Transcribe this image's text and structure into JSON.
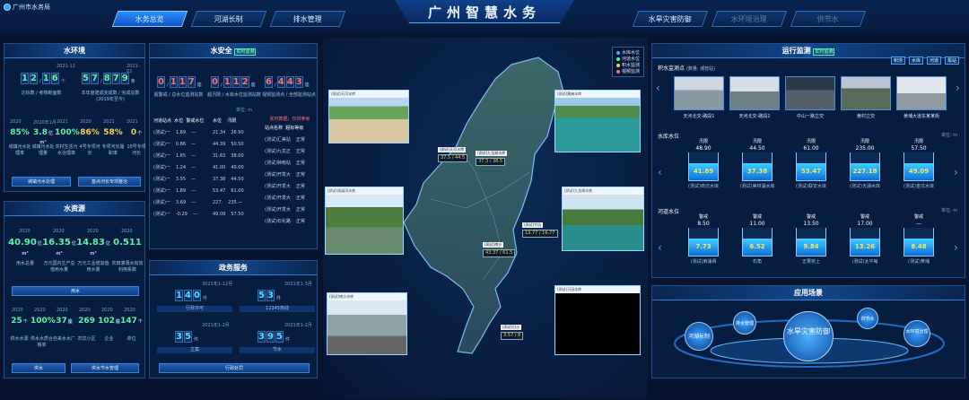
{
  "header": {
    "logo": "广州市水务局",
    "title": "广州智慧水务",
    "tabs_left": [
      "水务总览",
      "河湖长制",
      "排水管理"
    ],
    "tabs_right": [
      "水旱灾害防御",
      "水环境治理",
      "供节水"
    ]
  },
  "water_env": {
    "title": "水环境",
    "years": [
      "2021-12",
      "2021-02"
    ],
    "d1": [
      "1",
      "2",
      "1",
      "6"
    ],
    "d1_unit": "个",
    "d1_label": "达标数 / 考核断面数",
    "d2": [
      "5",
      "7",
      "8",
      "7",
      "9"
    ],
    "d2_unit": "条",
    "d2_label": "本年度建成完成数 / 完成总数 (2019年至今)",
    "rate_years": [
      "2020",
      "2020年1月",
      "2021",
      "2020",
      "2021",
      "2021"
    ],
    "rates": [
      {
        "value": "85%",
        "label": "城镇污水处理率",
        "color": "#5ff0a6"
      },
      {
        "value": "3.8",
        "unit": "亿m³",
        "label": "城镇污水处理量",
        "color": "#5ff0a6"
      },
      {
        "value": "100%",
        "label": "农村生活污水治理率",
        "color": "#5ff0a6"
      },
      {
        "value": "86%",
        "label": "4号专项河长",
        "color": "#f3d34a"
      },
      {
        "value": "58%",
        "label": "专项河长履职率",
        "color": "#f3d34a"
      },
      {
        "value": "0",
        "unit": "个",
        "label": "10号专项河长",
        "color": "#f3d34a"
      }
    ],
    "buttons": [
      "城镇污水处理",
      "基点河长专项整治"
    ]
  },
  "water_res": {
    "title": "水资源",
    "years": [
      "2020",
      "2020",
      "2020",
      "2020"
    ],
    "items": [
      {
        "value": "40.90",
        "unit": "亿m³",
        "label": "用水总量"
      },
      {
        "value": "16.35",
        "unit": "亿m³",
        "label": "万元国内生产总值用水量"
      },
      {
        "value": "14.83",
        "unit": "亿m³",
        "label": "万元工业增加值用水量"
      },
      {
        "value": "0.511",
        "unit": "",
        "label": "农田灌溉水有效利用系数"
      }
    ],
    "section1": "用水",
    "years2": [
      "2020",
      "2020",
      "2020",
      "2020",
      "2020",
      "2020"
    ],
    "items2": [
      {
        "value": "25",
        "unit": "个",
        "label": "供水水源"
      },
      {
        "value": "100%",
        "unit": "",
        "label": "供水水质合格率"
      },
      {
        "value": "37",
        "unit": "座",
        "label": "自来水水厂"
      },
      {
        "value": "269",
        "unit": "",
        "label": "农饮小区"
      },
      {
        "value": "102",
        "unit": "座",
        "label": "企业"
      },
      {
        "value": "147",
        "unit": "个",
        "label": "单位"
      }
    ],
    "buttons": [
      "供水",
      "供水节水管理"
    ]
  },
  "water_safety": {
    "title": "水安全",
    "tag": "实时监测",
    "d1": [
      "0",
      "1",
      "1",
      "7"
    ],
    "d1_unit": "座",
    "d1_label": "超警戒 / 总水位监测站数",
    "d2": [
      "0",
      "1",
      "1",
      "2"
    ],
    "d2_unit": "座",
    "d2_label": "超汛限 / 水库水位监测站数",
    "d3": [
      "6",
      "4",
      "4",
      "3"
    ],
    "d3_unit": "座",
    "d3_label": "视频监测点 / 全部监测站点",
    "unit_note": "单位: m",
    "left_headers": [
      "河道站点",
      "水位",
      "警戒水位"
    ],
    "left_rows": [
      [
        "(测试)一",
        "1.89",
        "—"
      ],
      [
        "(测试)一",
        "0.86",
        "—"
      ],
      [
        "(测试)一",
        "1.65",
        "—"
      ],
      [
        "(测试)一",
        "1.24",
        "—"
      ],
      [
        "(测试)一",
        "3.55",
        "—"
      ],
      [
        "(测试)一",
        "1.89",
        "—"
      ],
      [
        "(测试)一",
        "3.69",
        "—"
      ],
      [
        "(测试)一",
        "-0.29",
        "—"
      ]
    ],
    "mid_headers": [
      "水位",
      "汛限"
    ],
    "mid_rows": [
      [
        "21.34",
        "26.90"
      ],
      [
        "44.39",
        "50.50"
      ],
      [
        "31.63",
        "38.00"
      ],
      [
        "41.00",
        "49.00"
      ],
      [
        "37.38",
        "44.50"
      ],
      [
        "53.47",
        "61.00"
      ],
      [
        "227.",
        "235.—"
      ],
      [
        "49.09",
        "57.50"
      ]
    ],
    "right_note": "实时数据，仅供参考",
    "right_headers": [
      "站点名称",
      "超标等级"
    ],
    "right_rows": [
      [
        "(测试)汇美站",
        "正常"
      ],
      [
        "(测试)九龙正",
        "正常"
      ],
      [
        "(测试)钟南站",
        "正常"
      ],
      [
        "(测试)开发大",
        "正常"
      ],
      [
        "(测试)开发大",
        "正常"
      ],
      [
        "(测试)开发大",
        "正常"
      ],
      [
        "(测试)开发大",
        "正常"
      ],
      [
        "(测试)石化路",
        "正常"
      ]
    ]
  },
  "gov": {
    "title": "政务服务",
    "items": [
      {
        "date": "2021年1-12月",
        "digits": [
          "1",
          "4",
          "0"
        ],
        "unit": "件",
        "label": "行政许可"
      },
      {
        "date": "2021年1-3月",
        "digits": [
          "5",
          "3"
        ],
        "unit": "件",
        "label": "12345热线"
      },
      {
        "date": "2021年1-2月",
        "digits": [
          "3",
          "5"
        ],
        "unit": "件",
        "label": "立案"
      },
      {
        "date": "2021年1-2月",
        "digits": [
          "3",
          "9",
          "5"
        ],
        "unit": "件",
        "label": "节水"
      }
    ],
    "button": "行政处罚"
  },
  "map": {
    "legend": [
      "水库水位",
      "河道水位",
      "积水监测",
      "视频监测"
    ],
    "photos": [
      "(测试)天河水库",
      "(测试)黄麻水库",
      "(测试)流溪河水库",
      "(测试)九龙湖水库",
      "(测试)南沙水库",
      "(测试)万田水库"
    ],
    "labels": [
      "(测试)天河水库",
      "(测试)九龙湖水库",
      "(测试)竹坑",
      "(测试)南沙",
      "(测试)白沙"
    ],
    "values": [
      "37.5 / 44.5",
      "37.3 / 38.5",
      "19.77 / 16.77",
      "43.37 / 61.5",
      "3.57 / 8"
    ]
  },
  "ops": {
    "title": "运行监测",
    "tag": "实时监测",
    "type_tags": [
      "积涝",
      "水库",
      "河道",
      "泵站"
    ],
    "ponding_title": "积水监测点",
    "ponding_sub": "(数量: 城管站)",
    "thumbs": [
      "天河北交-路段1",
      "天河北交-路段2",
      "中山一路立交",
      "黄村立交",
      "黄埔大道东某某街"
    ],
    "reservoir_title": "水库水位",
    "reservoir_unit": "单位: m",
    "gauges1": [
      {
        "top_label": "汛限",
        "top": "48.90",
        "val": "41.89",
        "name": "(测试)南坑水库"
      },
      {
        "top_label": "汛限",
        "top": "44.50",
        "val": "37.38",
        "name": "(测试)美林湖水库"
      },
      {
        "top_label": "汛限",
        "top": "61.00",
        "val": "53.47",
        "name": "(测试)联安水库"
      },
      {
        "top_label": "汛限",
        "top": "235.00",
        "val": "227.18",
        "name": "(测试)天湖水库"
      },
      {
        "top_label": "汛限",
        "top": "57.50",
        "val": "49.09",
        "name": "(测试)金坑水库"
      }
    ],
    "river_title": "河道水位",
    "river_unit": "单位: m",
    "gauges2": [
      {
        "top_label": "警戒",
        "top": "8.50",
        "val": "7.73",
        "name": "(测试)麻涌闸"
      },
      {
        "top_label": "警戒",
        "top": "11.00",
        "val": "6.52",
        "name": "石角"
      },
      {
        "top_label": "警戒",
        "top": "13.50",
        "val": "9.84",
        "name": "正果桥上"
      },
      {
        "top_label": "警戒",
        "top": "17.00",
        "val": "13.26",
        "name": "(测试)太平每"
      },
      {
        "top_label": "警戒",
        "top": "—",
        "val": "8.48",
        "name": "(测试)黄埔"
      }
    ]
  },
  "apps": {
    "title": "应用场景",
    "items": [
      "河湖长制",
      "排水管理",
      "水旱灾害防御",
      "供节水",
      "水环境治理"
    ]
  },
  "colors": {
    "accent": "#2a8cff",
    "green": "#5ff0a6",
    "yellow": "#f3d34a",
    "panel": "#081e42"
  }
}
